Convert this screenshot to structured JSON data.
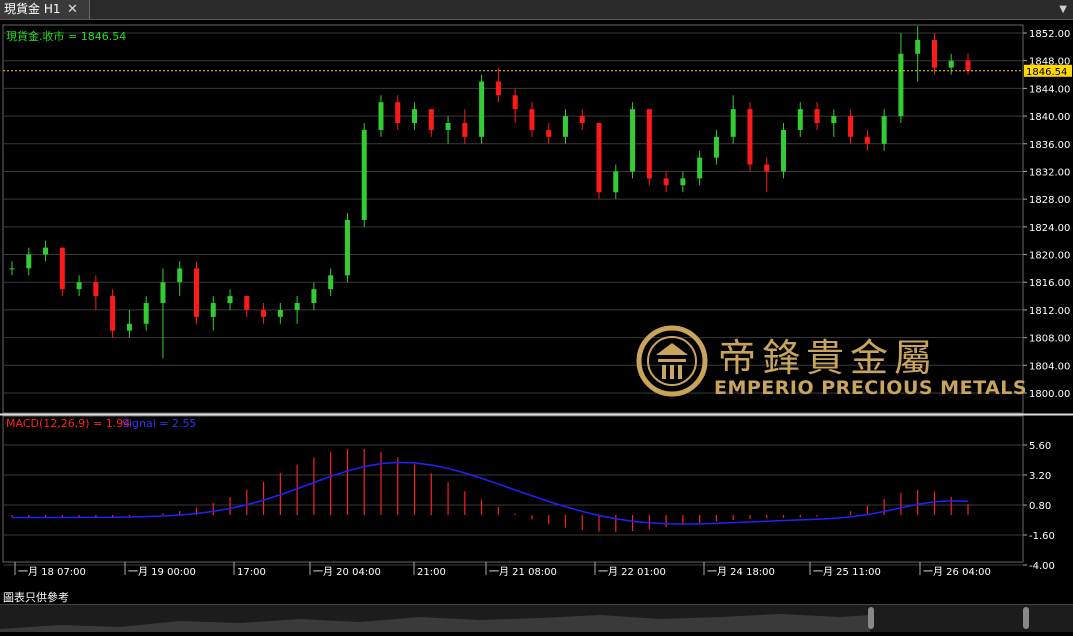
{
  "window": {
    "tab_label": "現貨金 H1",
    "tab_close_glyph": "✕",
    "menu_glyph": "▼"
  },
  "main_panel": {
    "legend": "現貨金.收市 = 1846.54",
    "current_price_label": "1846.54",
    "y_ticks": [
      "1852.00",
      "1848.00",
      "1844.00",
      "1840.00",
      "1836.00",
      "1832.00",
      "1828.00",
      "1824.00",
      "1820.00",
      "1816.00",
      "1812.00",
      "1808.00",
      "1804.00",
      "1800.00"
    ]
  },
  "macd_panel": {
    "legend_macd": "MACD(12,26,9) = 1.94",
    "legend_signal": "Signal = 2.55",
    "y_ticks": [
      "5.60",
      "3.20",
      "0.80",
      "-1.60",
      "-4.00"
    ]
  },
  "x_ticks": [
    "一月 18 07:00",
    "一月 19 00:00",
    "17:00",
    "一月 20 04:00",
    "21:00",
    "一月 21 08:00",
    "一月 22 01:00",
    "一月 24 18:00",
    "一月 25 11:00",
    "一月 26 04:00"
  ],
  "footer": {
    "disclaimer": "圖表只供參考"
  },
  "logo": {
    "chinese": "帝鋒貴金屬",
    "english": "EMPERIO PRECIOUS METALS"
  },
  "colors": {
    "up": "#33cc33",
    "down": "#ff1a1a",
    "macd": "#ff2020",
    "signal": "#2222ff",
    "price_line": "#ffcc00",
    "grid": "#3a3a3a",
    "gold": "#c9a45c"
  },
  "chart_data": {
    "type": "candlestick",
    "symbol": "現貨金",
    "timeframe": "H1",
    "ylim": [
      1800,
      1853
    ],
    "last_close": 1846.54,
    "candles_ohlc_approx": [
      [
        1818,
        1819,
        1817,
        1818
      ],
      [
        1818,
        1821,
        1817,
        1820
      ],
      [
        1820,
        1822,
        1819,
        1821
      ],
      [
        1821,
        1821,
        1814,
        1815
      ],
      [
        1815,
        1817,
        1814,
        1816
      ],
      [
        1816,
        1817,
        1812,
        1814
      ],
      [
        1814,
        1815,
        1808,
        1809
      ],
      [
        1809,
        1812,
        1808,
        1810
      ],
      [
        1810,
        1814,
        1809,
        1813
      ],
      [
        1813,
        1818,
        1805,
        1816
      ],
      [
        1816,
        1819,
        1814,
        1818
      ],
      [
        1818,
        1819,
        1810,
        1811
      ],
      [
        1811,
        1814,
        1809,
        1813
      ],
      [
        1813,
        1815,
        1812,
        1814
      ],
      [
        1814,
        1814,
        1811,
        1812
      ],
      [
        1812,
        1813,
        1810,
        1811
      ],
      [
        1811,
        1813,
        1810,
        1812
      ],
      [
        1812,
        1814,
        1810,
        1813
      ],
      [
        1813,
        1816,
        1812,
        1815
      ],
      [
        1815,
        1818,
        1814,
        1817
      ],
      [
        1817,
        1826,
        1816,
        1825
      ],
      [
        1825,
        1839,
        1824,
        1838
      ],
      [
        1838,
        1843,
        1837,
        1842
      ],
      [
        1842,
        1843,
        1838,
        1839
      ],
      [
        1839,
        1842,
        1838,
        1841
      ],
      [
        1841,
        1841,
        1837,
        1838
      ],
      [
        1838,
        1840,
        1836,
        1839
      ],
      [
        1839,
        1841,
        1836,
        1837
      ],
      [
        1837,
        1846,
        1836,
        1845
      ],
      [
        1845,
        1847,
        1842,
        1843
      ],
      [
        1843,
        1844,
        1839,
        1841
      ],
      [
        1841,
        1842,
        1837,
        1838
      ],
      [
        1838,
        1839,
        1836,
        1837
      ],
      [
        1837,
        1841,
        1836,
        1840
      ],
      [
        1840,
        1841,
        1838,
        1839
      ],
      [
        1839,
        1839,
        1828,
        1829
      ],
      [
        1829,
        1833,
        1828,
        1832
      ],
      [
        1832,
        1842,
        1831,
        1841
      ],
      [
        1841,
        1841,
        1830,
        1831
      ],
      [
        1831,
        1832,
        1829,
        1830
      ],
      [
        1830,
        1832,
        1829,
        1831
      ],
      [
        1831,
        1835,
        1830,
        1834
      ],
      [
        1834,
        1838,
        1833,
        1837
      ],
      [
        1837,
        1843,
        1836,
        1841
      ],
      [
        1841,
        1842,
        1832,
        1833
      ],
      [
        1833,
        1834,
        1829,
        1832
      ],
      [
        1832,
        1839,
        1831,
        1838
      ],
      [
        1838,
        1842,
        1837,
        1841
      ],
      [
        1841,
        1842,
        1838,
        1839
      ],
      [
        1839,
        1841,
        1837,
        1840
      ],
      [
        1840,
        1841,
        1836,
        1837
      ],
      [
        1837,
        1838,
        1835,
        1836
      ],
      [
        1836,
        1841,
        1835,
        1840
      ],
      [
        1840,
        1852,
        1839,
        1849
      ],
      [
        1849,
        1853,
        1845,
        1851
      ],
      [
        1851,
        1852,
        1846,
        1847
      ],
      [
        1847,
        1849,
        1846,
        1848
      ],
      [
        1848,
        1849,
        1846,
        1846.54
      ]
    ],
    "macd_series_approx": {
      "name_macd": "MACD(12,26,9)",
      "name_signal": "Signal",
      "last_macd": 1.94,
      "last_signal": 2.55
    }
  }
}
